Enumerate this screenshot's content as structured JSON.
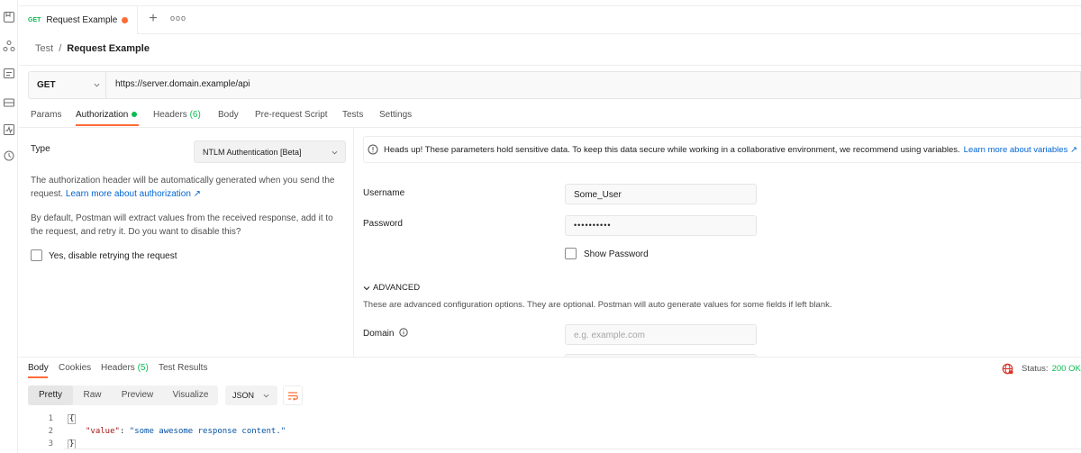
{
  "tab": {
    "method": "GET",
    "name": "Request Example"
  },
  "breadcrumb": {
    "parent": "Test",
    "separator": "/",
    "current": "Request Example"
  },
  "request": {
    "method": "GET",
    "url": "https://server.domain.example/api"
  },
  "request_tabs": [
    {
      "label": "Params",
      "active": false
    },
    {
      "label": "Authorization",
      "active": true,
      "dot": true
    },
    {
      "label": "Headers",
      "count": "(6)",
      "active": false
    },
    {
      "label": "Body",
      "active": false
    },
    {
      "label": "Pre-request Script",
      "active": false
    },
    {
      "label": "Tests",
      "active": false
    },
    {
      "label": "Settings",
      "active": false
    }
  ],
  "auth": {
    "type_label": "Type",
    "type_value": "NTLM Authentication [Beta]",
    "desc1": "The authorization header will be automatically generated when you send the request.",
    "desc1_link": "Learn more about authorization ↗",
    "desc2": "By default, Postman will extract values from the received response, add it to the request, and retry it. Do you want to disable this?",
    "disable_retry_label": "Yes, disable retrying the request",
    "banner_text": "Heads up! These parameters hold sensitive data. To keep this data secure while working in a collaborative environment, we recommend using variables.",
    "banner_link": "Learn more about variables ↗",
    "username_label": "Username",
    "username_value": "Some_User",
    "password_label": "Password",
    "password_value": "••••••••••",
    "show_password_label": "Show Password",
    "advanced_label": "ADVANCED",
    "advanced_desc": "These are advanced configuration options. They are optional. Postman will auto generate values for some fields if left blank.",
    "domain_label": "Domain",
    "domain_placeholder": "e.g. example.com"
  },
  "response": {
    "tabs": [
      {
        "label": "Body",
        "active": true
      },
      {
        "label": "Cookies",
        "active": false
      },
      {
        "label": "Headers",
        "count": "(5)",
        "active": false
      },
      {
        "label": "Test Results",
        "active": false
      }
    ],
    "status_label": "Status:",
    "status_value": "200 OK",
    "view_modes": [
      "Pretty",
      "Raw",
      "Preview",
      "Visualize"
    ],
    "active_view": "Pretty",
    "format": "JSON",
    "code_lines": [
      {
        "num": "1",
        "text": "{"
      },
      {
        "num": "2",
        "key": "\"value\"",
        "colon": ": ",
        "value": "\"some awesome response content.\""
      },
      {
        "num": "3",
        "text": "}"
      }
    ]
  },
  "colors": {
    "accent": "#ff6c37",
    "success": "#0cbb52",
    "link": "#0265d2"
  },
  "icons": [
    "collections-icon",
    "apis-icon",
    "environments-icon",
    "mock-servers-icon",
    "monitors-icon",
    "history-icon"
  ]
}
